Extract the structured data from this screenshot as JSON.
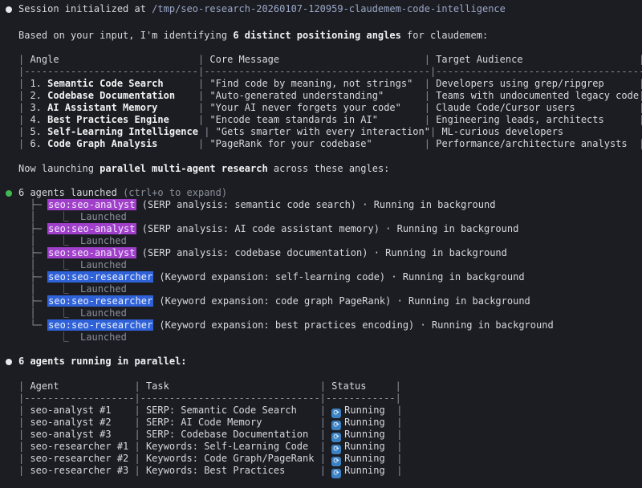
{
  "session": {
    "prefix": "Session initialized at ",
    "path": "/tmp/seo-research-20260107-120959-claudemem-code-intelligence"
  },
  "intro": {
    "before": "Based on your input, I'm identifying ",
    "bold": "6 distinct positioning angles",
    "after": " for claudemem:"
  },
  "angles_table": {
    "headers": [
      "Angle",
      "Core Message",
      "Target Audience"
    ],
    "rows": [
      {
        "num": "1. ",
        "angle": "Semantic Code Search",
        "message": "\"Find code by meaning, not strings\"",
        "audience": "Developers using grep/ripgrep"
      },
      {
        "num": "2. ",
        "angle": "Codebase Documentation",
        "message": "\"Auto-generated understanding\"",
        "audience": "Teams with undocumented legacy code"
      },
      {
        "num": "3. ",
        "angle": "AI Assistant Memory",
        "message": "\"Your AI never forgets your code\"",
        "audience": "Claude Code/Cursor users"
      },
      {
        "num": "4. ",
        "angle": "Best Practices Engine",
        "message": "\"Encode team standards in AI\"",
        "audience": "Engineering leads, architects"
      },
      {
        "num": "5. ",
        "angle": "Self-Learning Intelligence",
        "message": "\"Gets smarter with every interaction\"",
        "audience": "ML-curious developers"
      },
      {
        "num": "6. ",
        "angle": "Code Graph Analysis",
        "message": "\"PageRank for your codebase\"",
        "audience": "Performance/architecture analysts"
      }
    ]
  },
  "launch": {
    "before": "Now launching ",
    "bold": "parallel multi-agent research",
    "after": " across these angles:"
  },
  "agents_launched": {
    "title": "6 agents launched",
    "hint": "(ctrl+o to expand)",
    "status_sub": "Launched",
    "items": [
      {
        "tag": "seo:seo-analyst",
        "desc": " (SERP analysis: semantic code search) · Running in background"
      },
      {
        "tag": "seo:seo-analyst",
        "desc": " (SERP analysis: AI code assistant memory) · Running in background"
      },
      {
        "tag": "seo:seo-analyst",
        "desc": " (SERP analysis: codebase documentation) · Running in background"
      },
      {
        "tag": "seo:seo-researcher",
        "desc": " (Keyword expansion: self-learning code) · Running in background"
      },
      {
        "tag": "seo:seo-researcher",
        "desc": " (Keyword expansion: code graph PageRank) · Running in background"
      },
      {
        "tag": "seo:seo-researcher",
        "desc": " (Keyword expansion: best practices encoding) · Running in background"
      }
    ]
  },
  "running": {
    "title": "6 agents running in parallel:"
  },
  "status_table": {
    "headers": [
      "Agent",
      "Task",
      "Status"
    ],
    "rows": [
      {
        "agent": "seo-analyst #1",
        "task": "SERP: Semantic Code Search",
        "status": "Running"
      },
      {
        "agent": "seo-analyst #2",
        "task": "SERP: AI Code Memory",
        "status": "Running"
      },
      {
        "agent": "seo-analyst #3",
        "task": "SERP: Codebase Documentation",
        "status": "Running"
      },
      {
        "agent": "seo-researcher #1",
        "task": "Keywords: Self-Learning Code",
        "status": "Running"
      },
      {
        "agent": "seo-researcher #2",
        "task": "Keywords: Code Graph/PageRank",
        "status": "Running"
      },
      {
        "agent": "seo-researcher #3",
        "task": "Keywords: Best Practices",
        "status": "Running"
      }
    ]
  },
  "colors": {
    "background": "#1c1d22",
    "analyst_tag": "#a03fc9",
    "researcher_tag": "#2f62d8",
    "success_dot": "#3fb950"
  }
}
